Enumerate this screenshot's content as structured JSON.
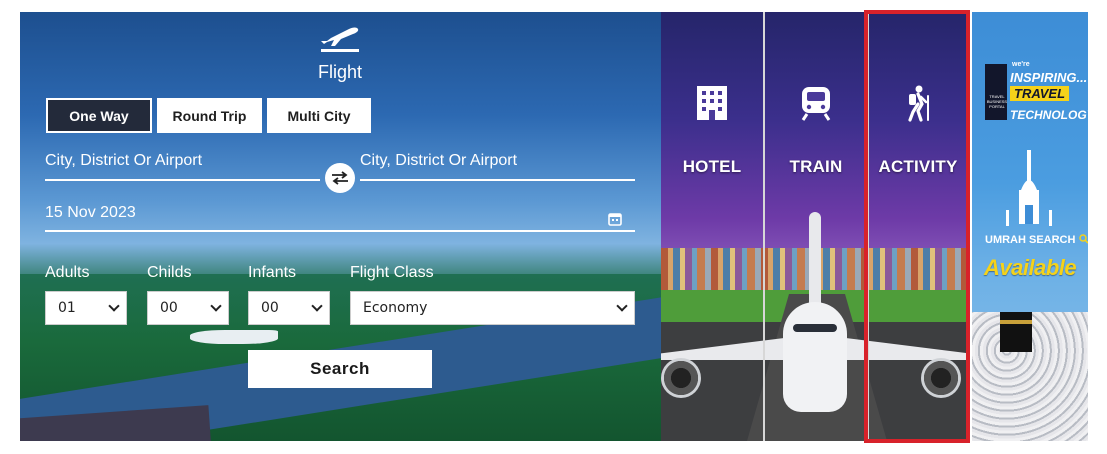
{
  "flight": {
    "icon": "airplane-takeoff-icon",
    "title": "Flight",
    "trip_types": [
      {
        "label": "One Way",
        "active": true
      },
      {
        "label": "Round Trip",
        "active": false
      },
      {
        "label": "Multi City",
        "active": false
      }
    ],
    "from": {
      "value": "City, District Or Airport"
    },
    "to": {
      "value": "City, District Or Airport"
    },
    "swap_icon": "swap-arrows-icon",
    "date": {
      "value": "15 Nov 2023",
      "icon": "calendar-icon"
    },
    "passengers": {
      "adults": {
        "label": "Adults",
        "value": "01"
      },
      "childs": {
        "label": "Childs",
        "value": "00"
      },
      "infants": {
        "label": "Infants",
        "value": "00"
      },
      "flight_class": {
        "label": "Flight Class",
        "value": "Economy"
      }
    },
    "search_label": "Search"
  },
  "services": [
    {
      "label": "HOTEL",
      "icon": "hotel-icon"
    },
    {
      "label": "TRAIN",
      "icon": "train-icon"
    },
    {
      "label": "ACTIVITY",
      "icon": "hiker-icon",
      "highlighted": true
    }
  ],
  "ad": {
    "logo_text": "TRAVEL BUSINESS PORTAL",
    "were": "we're",
    "line1": "INSPIRING...",
    "line2": "TRAVEL",
    "line3": "TECHNOLOGY",
    "umrah": "UMRAH SEARCH",
    "available": "Available"
  },
  "colors": {
    "highlight": "#d8222a",
    "active_tab": "#232a3a",
    "ad_yellow": "#f5d21a"
  }
}
